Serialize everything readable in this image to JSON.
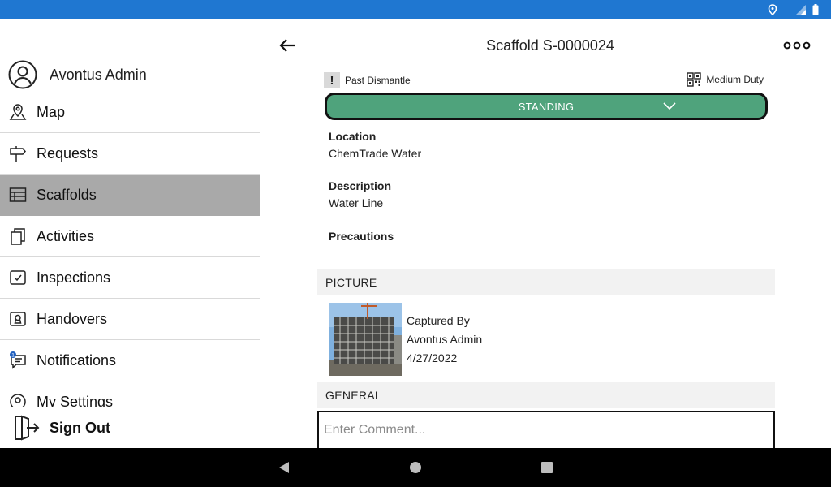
{
  "colors": {
    "status_bar": "#1f77d1",
    "status_select": "#4fa37c",
    "active_menu": "#a9a9a9"
  },
  "sidebar": {
    "user_name": "Avontus Admin",
    "items": [
      {
        "label": "Map",
        "icon": "map-pin-icon"
      },
      {
        "label": "Requests",
        "icon": "signpost-icon"
      },
      {
        "label": "Scaffolds",
        "icon": "table-icon",
        "active": true
      },
      {
        "label": "Activities",
        "icon": "copy-icon"
      },
      {
        "label": "Inspections",
        "icon": "checkbox-icon"
      },
      {
        "label": "Handovers",
        "icon": "certificate-icon"
      },
      {
        "label": "Notifications",
        "icon": "notification-icon",
        "badge": "1"
      },
      {
        "label": "My Settings",
        "icon": "user-settings-icon"
      }
    ],
    "sign_out": "Sign Out"
  },
  "header": {
    "title": "Scaffold S-0000024"
  },
  "tags": {
    "flag": "Past Dismantle",
    "flag_mark": "!",
    "duty": "Medium Duty"
  },
  "status": {
    "selected": "STANDING"
  },
  "fields": {
    "location_label": "Location",
    "location_value": "ChemTrade Water",
    "description_label": "Description",
    "description_value": "Water Line",
    "precautions_label": "Precautions"
  },
  "picture": {
    "section_title": "PICTURE",
    "captured_by_label": "Captured By",
    "captured_by": "Avontus Admin",
    "date": "4/27/2022"
  },
  "general": {
    "section_title": "GENERAL",
    "comment_placeholder": "Enter Comment..."
  }
}
